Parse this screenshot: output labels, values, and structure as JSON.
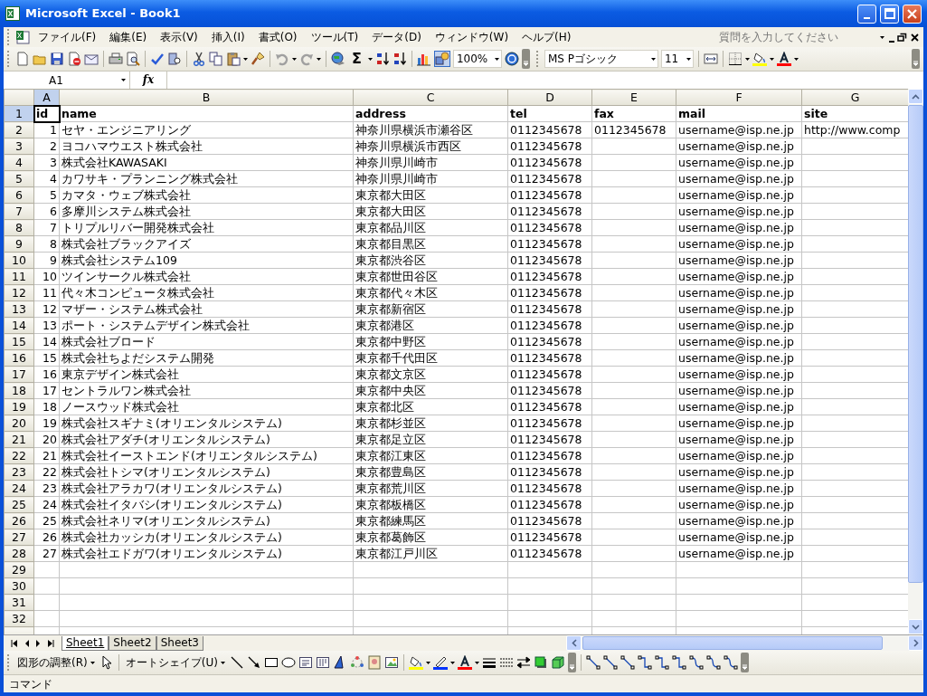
{
  "window": {
    "title": "Microsoft Excel - Book1"
  },
  "menu": [
    "ファイル(F)",
    "編集(E)",
    "表示(V)",
    "挿入(I)",
    "書式(O)",
    "ツール(T)",
    "データ(D)",
    "ウィンドウ(W)",
    "ヘルプ(H)"
  ],
  "help_box": {
    "placeholder": "質問を入力してください"
  },
  "toolbar": {
    "autosum_symbol": "Σ",
    "drawing_on": true,
    "zoom": "100%",
    "font": "MS Pゴシック",
    "font_size": "11"
  },
  "formula_bar": {
    "name_box": "A1",
    "function_label": "fx"
  },
  "sheet": {
    "columns": [
      {
        "label": "A",
        "selected": true
      },
      {
        "label": "B",
        "selected": false
      },
      {
        "label": "C",
        "selected": false
      },
      {
        "label": "D",
        "selected": false
      },
      {
        "label": "E",
        "selected": false
      },
      {
        "label": "F",
        "selected": false
      },
      {
        "label": "G",
        "selected": false
      }
    ],
    "rows": [
      {
        "number": "1",
        "selected": true,
        "kind": "header",
        "cells": [
          "id",
          "name",
          "address",
          "tel",
          "fax",
          "mail",
          "site"
        ]
      },
      {
        "number": "2",
        "selected": false,
        "kind": "data",
        "cells": [
          "1",
          "セヤ・エンジニアリング",
          "神奈川県横浜市瀬谷区",
          "0112345678",
          "0112345678",
          "username@isp.ne.jp",
          "http://www.comp"
        ]
      },
      {
        "number": "3",
        "selected": false,
        "kind": "data",
        "cells": [
          "2",
          "ヨコハマウエスト株式会社",
          "神奈川県横浜市西区",
          "0112345678",
          null,
          "username@isp.ne.jp"
        ]
      },
      {
        "number": "4",
        "selected": false,
        "kind": "data",
        "cells": [
          "3",
          "株式会社KAWASAKI",
          "神奈川県川崎市",
          "0112345678",
          null,
          "username@isp.ne.jp"
        ]
      },
      {
        "number": "5",
        "selected": false,
        "kind": "data",
        "cells": [
          "4",
          "カワサキ・プランニング株式会社",
          "神奈川県川崎市",
          "0112345678",
          null,
          "username@isp.ne.jp"
        ]
      },
      {
        "number": "6",
        "selected": false,
        "kind": "data",
        "cells": [
          "5",
          "カマタ・ウェブ株式会社",
          "東京都大田区",
          "0112345678",
          null,
          "username@isp.ne.jp"
        ]
      },
      {
        "number": "7",
        "selected": false,
        "kind": "data",
        "cells": [
          "6",
          "多摩川システム株式会社",
          "東京都大田区",
          "0112345678",
          null,
          "username@isp.ne.jp"
        ]
      },
      {
        "number": "8",
        "selected": false,
        "kind": "data",
        "cells": [
          "7",
          "トリプルリバー開発株式会社",
          "東京都品川区",
          "0112345678",
          null,
          "username@isp.ne.jp"
        ]
      },
      {
        "number": "9",
        "selected": false,
        "kind": "data",
        "cells": [
          "8",
          "株式会社ブラックアイズ",
          "東京都目黒区",
          "0112345678",
          null,
          "username@isp.ne.jp"
        ]
      },
      {
        "number": "10",
        "selected": false,
        "kind": "data",
        "cells": [
          "9",
          "株式会社システム109",
          "東京都渋谷区",
          "0112345678",
          null,
          "username@isp.ne.jp"
        ]
      },
      {
        "number": "11",
        "selected": false,
        "kind": "data",
        "cells": [
          "10",
          "ツインサークル株式会社",
          "東京都世田谷区",
          "0112345678",
          null,
          "username@isp.ne.jp"
        ]
      },
      {
        "number": "12",
        "selected": false,
        "kind": "data",
        "cells": [
          "11",
          "代々木コンピュータ株式会社",
          "東京都代々木区",
          "0112345678",
          null,
          "username@isp.ne.jp"
        ]
      },
      {
        "number": "13",
        "selected": false,
        "kind": "data",
        "cells": [
          "12",
          "マザー・システム株式会社",
          "東京都新宿区",
          "0112345678",
          null,
          "username@isp.ne.jp"
        ]
      },
      {
        "number": "14",
        "selected": false,
        "kind": "data",
        "cells": [
          "13",
          "ポート・システムデザイン株式会社",
          "東京都港区",
          "0112345678",
          null,
          "username@isp.ne.jp"
        ]
      },
      {
        "number": "15",
        "selected": false,
        "kind": "data",
        "cells": [
          "14",
          "株式会社ブロード",
          "東京都中野区",
          "0112345678",
          null,
          "username@isp.ne.jp"
        ]
      },
      {
        "number": "16",
        "selected": false,
        "kind": "data",
        "cells": [
          "15",
          "株式会社ちよだシステム開発",
          "東京都千代田区",
          "0112345678",
          null,
          "username@isp.ne.jp"
        ]
      },
      {
        "number": "17",
        "selected": false,
        "kind": "data",
        "cells": [
          "16",
          "東京デザイン株式会社",
          "東京都文京区",
          "0112345678",
          null,
          "username@isp.ne.jp"
        ]
      },
      {
        "number": "18",
        "selected": false,
        "kind": "data",
        "cells": [
          "17",
          "セントラルワン株式会社",
          "東京都中央区",
          "0112345678",
          null,
          "username@isp.ne.jp"
        ]
      },
      {
        "number": "19",
        "selected": false,
        "kind": "data",
        "cells": [
          "18",
          "ノースウッド株式会社",
          "東京都北区",
          "0112345678",
          null,
          "username@isp.ne.jp"
        ]
      },
      {
        "number": "20",
        "selected": false,
        "kind": "data",
        "cells": [
          "19",
          "株式会社スギナミ(オリエンタルシステム)",
          "東京都杉並区",
          "0112345678",
          null,
          "username@isp.ne.jp"
        ]
      },
      {
        "number": "21",
        "selected": false,
        "kind": "data",
        "cells": [
          "20",
          "株式会社アダチ(オリエンタルシステム)",
          "東京都足立区",
          "0112345678",
          null,
          "username@isp.ne.jp"
        ]
      },
      {
        "number": "22",
        "selected": false,
        "kind": "data",
        "cells": [
          "21",
          "株式会社イーストエンド(オリエンタルシステム)",
          "東京都江東区",
          "0112345678",
          null,
          "username@isp.ne.jp"
        ]
      },
      {
        "number": "23",
        "selected": false,
        "kind": "data",
        "cells": [
          "22",
          "株式会社トシマ(オリエンタルシステム)",
          "東京都豊島区",
          "0112345678",
          null,
          "username@isp.ne.jp"
        ]
      },
      {
        "number": "24",
        "selected": false,
        "kind": "data",
        "cells": [
          "23",
          "株式会社アラカワ(オリエンタルシステム)",
          "東京都荒川区",
          "0112345678",
          null,
          "username@isp.ne.jp"
        ]
      },
      {
        "number": "25",
        "selected": false,
        "kind": "data",
        "cells": [
          "24",
          "株式会社イタバシ(オリエンタルシステム)",
          "東京都板橋区",
          "0112345678",
          null,
          "username@isp.ne.jp"
        ]
      },
      {
        "number": "26",
        "selected": false,
        "kind": "data",
        "cells": [
          "25",
          "株式会社ネリマ(オリエンタルシステム)",
          "東京都練馬区",
          "0112345678",
          null,
          "username@isp.ne.jp"
        ]
      },
      {
        "number": "27",
        "selected": false,
        "kind": "data",
        "cells": [
          "26",
          "株式会社カッシカ(オリエンタルシステム)",
          "東京都葛飾区",
          "0112345678",
          null,
          "username@isp.ne.jp"
        ]
      },
      {
        "number": "28",
        "selected": false,
        "kind": "data",
        "cells": [
          "27",
          "株式会社エドガワ(オリエンタルシステム)",
          "東京都江戸川区",
          "0112345678",
          null,
          "username@isp.ne.jp"
        ]
      },
      {
        "number": "29",
        "selected": false,
        "kind": "data",
        "cells": []
      },
      {
        "number": "30",
        "selected": false,
        "kind": "data",
        "cells": []
      },
      {
        "number": "31",
        "selected": false,
        "kind": "data",
        "cells": []
      },
      {
        "number": "32",
        "selected": false,
        "kind": "data",
        "cells": []
      }
    ]
  },
  "sheet_tabs": [
    {
      "label": "Sheet1",
      "selected": true
    },
    {
      "label": "Sheet2",
      "selected": false
    },
    {
      "label": "Sheet3",
      "selected": false
    }
  ],
  "drawing_toolbar": {
    "draw_menu": "図形の調整(R)",
    "autoshape_menu": "オートシェイプ(U)"
  },
  "status_bar": {
    "text": "コマンド"
  }
}
